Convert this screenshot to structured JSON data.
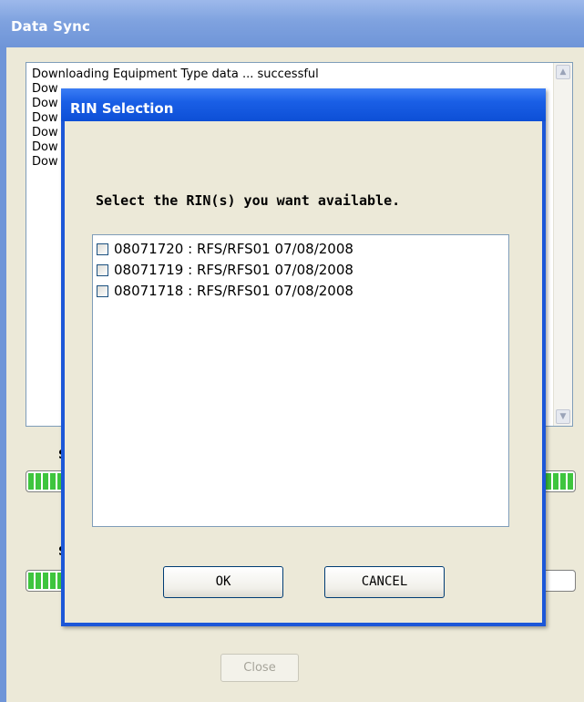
{
  "data_sync": {
    "title": "Data Sync",
    "log_lines": [
      "Downloading Equipment Type data ... successful",
      "Dow",
      "Dow",
      "Dow",
      "Dow",
      "Dow",
      "Dow"
    ],
    "progress_label_1_partial": "S",
    "progress_label_2_partial": "S",
    "progress_1_fraction": 1.0,
    "progress_2_fraction": 0.08,
    "close_label": "Close",
    "colors": {
      "title_bar": "#7fa2df",
      "window_bg": "#ece9d8",
      "progress_fill": "#3ec53e"
    }
  },
  "rin_dialog": {
    "title": "RIN Selection",
    "prompt": "Select the RIN(s) you want available.",
    "items": [
      {
        "label": "08071720 : RFS/RFS01 07/08/2008",
        "checked": false
      },
      {
        "label": "08071719 : RFS/RFS01 07/08/2008",
        "checked": false
      },
      {
        "label": "08071718 : RFS/RFS01 07/08/2008",
        "checked": false
      }
    ],
    "ok_label": "OK",
    "cancel_label": "CANCEL",
    "colors": {
      "title_bar": "#1a5fe6",
      "border": "#1c57d8"
    }
  },
  "icons": {
    "scroll_up": "chevron-up-icon",
    "scroll_down": "chevron-down-icon",
    "checkbox": "checkbox-icon"
  }
}
